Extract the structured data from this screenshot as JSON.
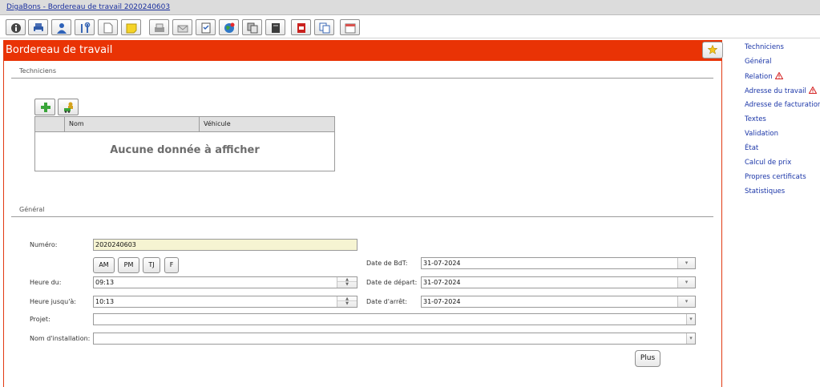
{
  "app": {
    "title": "DigaBons - Bordereau de travail 2020240603"
  },
  "toolbar": {
    "buttons": [
      "info-icon",
      "printer-icon",
      "person-icon",
      "tools-icon",
      "new-document-icon",
      "note-icon",
      "print-fax-icon",
      "email-icon",
      "checklist-icon",
      "globe-icon",
      "copy-stack-icon",
      "notebook-icon",
      "pdf-icon",
      "duplicate-icon",
      "calendar-icon"
    ]
  },
  "panel": {
    "title": "Bordereau de travail"
  },
  "sections": {
    "technicians": "Techniciens",
    "general": "Général"
  },
  "grid": {
    "columns": [
      "Nom",
      "Véhicule"
    ],
    "empty_text": "Aucune donnée à afficher"
  },
  "form": {
    "numero": {
      "label": "Numéro:",
      "value": "2020240603"
    },
    "quick_buttons": [
      "AM",
      "PM",
      "TJ",
      "F"
    ],
    "heure_du": {
      "label": "Heure du:",
      "value": "09:13"
    },
    "heure_jusqua": {
      "label": "Heure jusqu'à:",
      "value": "10:13"
    },
    "projet": {
      "label": "Projet:",
      "value": ""
    },
    "nom_installation": {
      "label": "Nom d'installation:",
      "value": ""
    },
    "date_bdt": {
      "label": "Date de BdT:",
      "value": "31-07-2024"
    },
    "date_depart": {
      "label": "Date de départ:",
      "value": "31-07-2024"
    },
    "date_arret": {
      "label": "Date d'arrêt:",
      "value": "31-07-2024"
    },
    "plus_label": "Plus"
  },
  "right_nav": {
    "items": [
      {
        "label": "Techniciens",
        "warning": false
      },
      {
        "label": "Général",
        "warning": false
      },
      {
        "label": "Relation",
        "warning": true
      },
      {
        "label": "Adresse du travail",
        "warning": true
      },
      {
        "label": "Adresse de facturation",
        "warning": false
      },
      {
        "label": "Textes",
        "warning": false
      },
      {
        "label": "Validation",
        "warning": false
      },
      {
        "label": "État",
        "warning": false
      },
      {
        "label": "Calcul de prix",
        "warning": false
      },
      {
        "label": "Propres certificats",
        "warning": false
      },
      {
        "label": "Statistiques",
        "warning": false
      }
    ]
  },
  "colors": {
    "accent": "#e93305",
    "link": "#1b36a8",
    "warning": "#d42020"
  }
}
